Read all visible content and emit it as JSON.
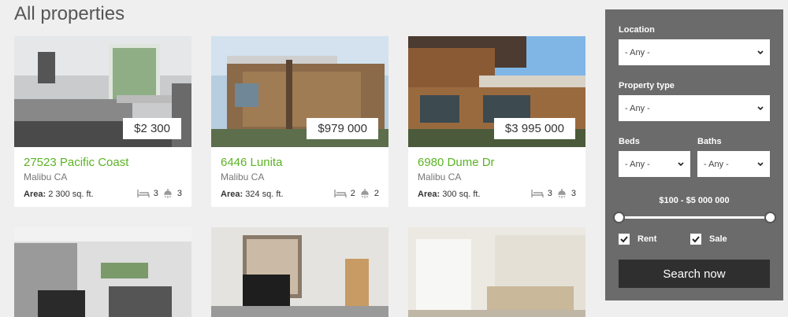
{
  "page": {
    "title": "All properties"
  },
  "listings": [
    {
      "price": "$2 300",
      "title": "27523 Pacific Coast",
      "city": "Malibu CA",
      "area_label": "Area:",
      "area_value": "2 300 sq. ft.",
      "beds": "3",
      "baths": "3"
    },
    {
      "price": "$979 000",
      "title": "6446 Lunita",
      "city": "Malibu CA",
      "area_label": "Area:",
      "area_value": "324 sq. ft.",
      "beds": "2",
      "baths": "2"
    },
    {
      "price": "$3 995 000",
      "title": "6980 Dume Dr",
      "city": "Malibu CA",
      "area_label": "Area:",
      "area_value": "300 sq. ft.",
      "beds": "3",
      "baths": "3"
    }
  ],
  "filters": {
    "location_label": "Location",
    "location_value": "- Any -",
    "type_label": "Property type",
    "type_value": "- Any -",
    "beds_label": "Beds",
    "beds_value": "- Any -",
    "baths_label": "Baths",
    "baths_value": "- Any -",
    "price_range": "$100 - $5 000 000",
    "rent_label": "Rent",
    "sale_label": "Sale",
    "rent_checked": true,
    "sale_checked": true,
    "search_label": "Search now"
  },
  "icons": {
    "bed": "bed-icon",
    "bath": "shower-icon",
    "chevron": "chevron-down-icon",
    "check": "check-icon"
  }
}
